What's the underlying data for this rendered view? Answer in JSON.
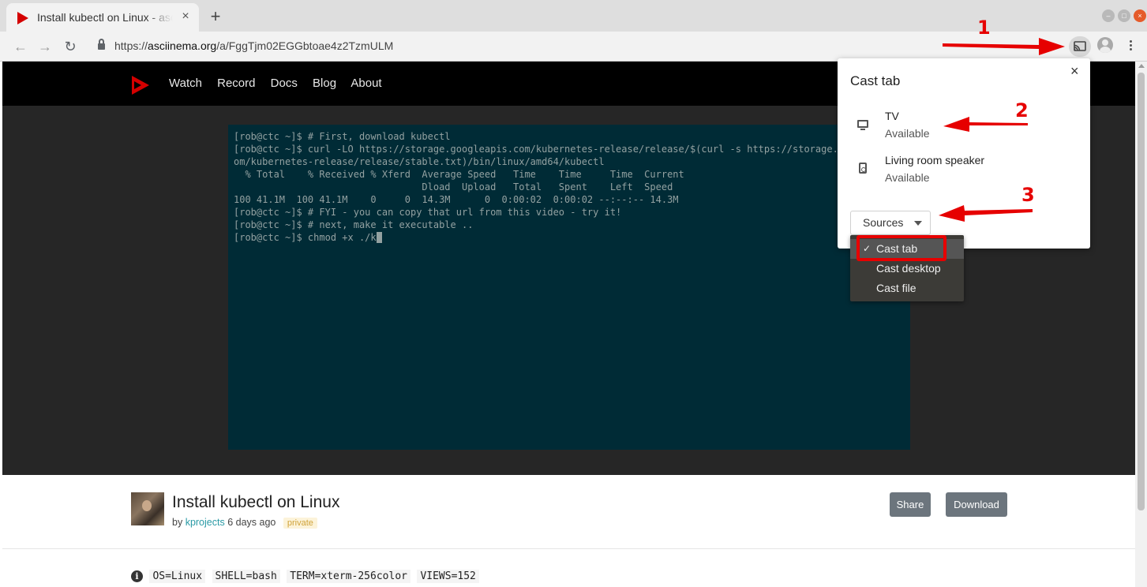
{
  "browser": {
    "tab_title": "Install kubectl on Linux - asciinema",
    "tab_close": "×",
    "new_tab": "+",
    "url_prefix": "https://",
    "url_host": "asciinema.org",
    "url_path": "/a/FggTjm02EGGbtoae4z2TzmULM",
    "back_icon": "←",
    "forward_icon": "→",
    "reload_icon": "↻",
    "window_min": "–",
    "window_max": "□",
    "window_close": "×"
  },
  "site": {
    "nav": [
      "Watch",
      "Record",
      "Docs",
      "Blog",
      "About"
    ]
  },
  "terminal": {
    "lines": [
      "[rob@ctc ~]$ # First, download kubectl",
      "[rob@ctc ~]$ curl -LO https://storage.googleapis.com/kubernetes-release/release/$(curl -s https://storage.googleapis.c",
      "om/kubernetes-release/release/stable.txt)/bin/linux/amd64/kubectl",
      "  % Total    % Received % Xferd  Average Speed   Time    Time     Time  Current",
      "                                 Dload  Upload   Total   Spent    Left  Speed",
      "100 41.1M  100 41.1M    0     0  14.3M      0  0:00:02  0:00:02 --:--:-- 14.3M",
      "[rob@ctc ~]$ # FYI - you can copy that url from this video - try it!",
      "[rob@ctc ~]$ # next, make it executable ..",
      "[rob@ctc ~]$ chmod +x ./k"
    ]
  },
  "recording": {
    "title": "Install kubectl on Linux",
    "by": "by",
    "author": "kprojects",
    "age": "6 days ago",
    "badge": "private",
    "share_label": "Share",
    "download_label": "Download",
    "info_icon": "i",
    "env": [
      "OS=Linux",
      "SHELL=bash",
      "TERM=xterm-256color",
      "VIEWS=152"
    ]
  },
  "cast_dialog": {
    "title": "Cast tab",
    "close": "×",
    "sinks": [
      {
        "name": "TV",
        "status": "Available",
        "icon": "tv-icon"
      },
      {
        "name": "Living room speaker",
        "status": "Available",
        "icon": "speaker-icon"
      }
    ],
    "sources_label": "Sources",
    "sources_menu": [
      {
        "label": "Cast tab",
        "checked": true
      },
      {
        "label": "Cast desktop",
        "checked": false
      },
      {
        "label": "Cast file",
        "checked": false
      }
    ],
    "check_mark": "✓"
  },
  "annotations": {
    "numbers": [
      "1",
      "2",
      "3"
    ],
    "color": "#e60000"
  },
  "colors": {
    "terminal_bg": "#002b36",
    "terminal_fg": "#93a1a1",
    "brand_red": "#d40000",
    "author_link": "#2a9aa5"
  }
}
